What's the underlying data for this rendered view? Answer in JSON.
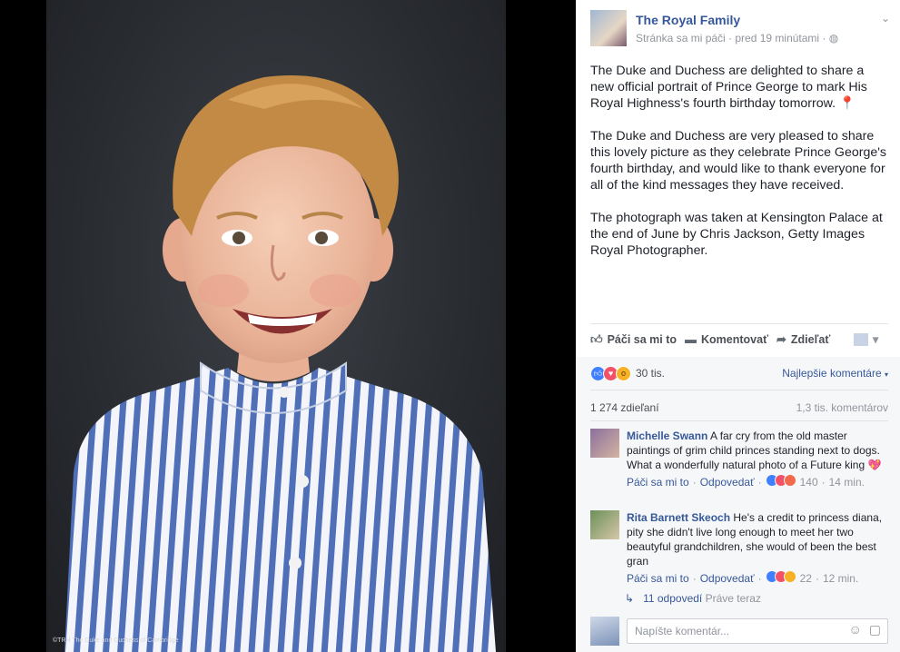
{
  "photo": {
    "credit": "©TRH The Duke and Duchess of Cambridge",
    "description": "Portrait of a smiling boy with blond hair wearing a blue and white striped shirt against a dark grey background"
  },
  "post": {
    "page_name": "The Royal Family",
    "meta": "Stránka sa mi páči · pred 19 minútami · ",
    "globe_icon": "◍",
    "chevron": "⌄",
    "paragraphs": [
      "The Duke and Duchess are delighted to share a new official portrait of Prince George to mark His Royal Highness's fourth birthday tomorrow.",
      "The Duke and Duchess are very pleased to share this lovely picture as they celebrate Prince George's fourth birthday, and would like to thank everyone for all of the kind messages they have received.",
      "The photograph was taken at Kensington Palace at the end of June by Chris Jackson, Getty Images Royal Photographer."
    ],
    "pin_emoji": "📍"
  },
  "actions": {
    "like": "Páči sa mi to",
    "comment": "Komentovať",
    "share": "Zdieľať"
  },
  "stats": {
    "reactions_count": "30 tis.",
    "sort_label": "Najlepšie komentáre",
    "shares": "1 274 zdieľaní",
    "comments": "1,3 tis. komentárov"
  },
  "comments": [
    {
      "author": "Michelle Swann",
      "text": "A far cry from the old master paintings of grim child princes standing next to dogs. What a wonderfully natural photo of a Future king",
      "emoji": "💖",
      "like": "Páči sa mi to",
      "reply": "Odpovedať",
      "count": "140",
      "time": "14 min."
    },
    {
      "author": "Rita Barnett Skeoch",
      "text": "He's a credit to princess diana, pity she didn't live long enough to meet her two beautyful grandchildren, she would of been the best gran",
      "emoji": "",
      "like": "Páči sa mi to",
      "reply": "Odpovedať",
      "count": "22",
      "time": "12 min."
    }
  ],
  "replies": {
    "label": "11 odpovedí",
    "time": "Práve teraz"
  },
  "composer": {
    "placeholder": "Napíšte komentár..."
  },
  "colors": {
    "link": "#365899",
    "text": "#1d2129",
    "muted": "#90949c",
    "like_blue": "#4080ff",
    "love_red": "#f25268",
    "wow_yellow": "#f7b125"
  }
}
